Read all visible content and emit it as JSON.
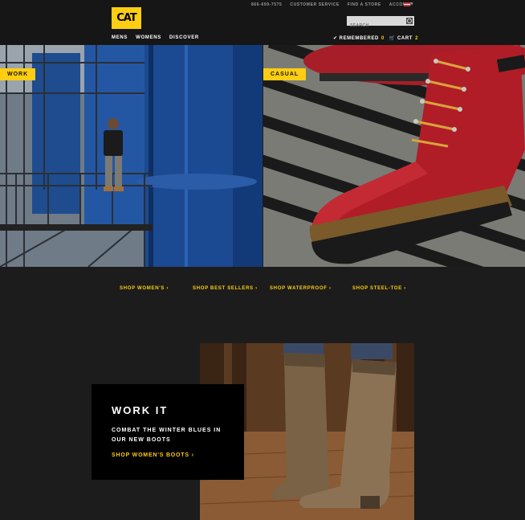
{
  "header": {
    "utility_links": [
      "866-699-7575",
      "CUSTOMER SERVICE",
      "FIND A STORE",
      "ACCOUNT"
    ],
    "logo_text": "CAT",
    "search_placeholder": "SEARCH",
    "main_nav": [
      "MENS",
      "WOMENS",
      "DISCOVER"
    ],
    "remembered_label": "REMEMBERED",
    "remembered_count": "0",
    "cart_label": "CART",
    "cart_count": "2"
  },
  "hero": {
    "work_label": "WORK",
    "casual_label": "CASUAL"
  },
  "shop_links": [
    "SHOP WOMEN'S",
    "SHOP BEST SELLERS",
    "SHOP WATERPROOF",
    "SHOP STEEL-TOE"
  ],
  "promo": {
    "title": "WORK IT",
    "subtitle": "COMBAT THE WINTER BLUES IN OUR NEW BOOTS",
    "link": "SHOP WOMEN'S BOOTS"
  },
  "colors": {
    "accent": "#ffcd11",
    "background": "#1c1c1c",
    "header": "#161616"
  },
  "icons": {
    "remembered": "check-icon",
    "cart": "cart-icon",
    "link_arrow": "chevron-right-icon",
    "search": "search-icon"
  }
}
